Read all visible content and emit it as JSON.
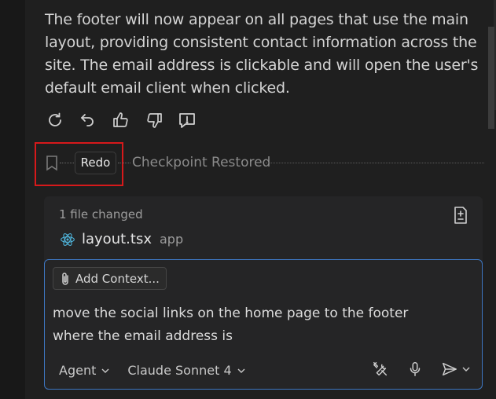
{
  "response": {
    "text": "The footer will now appear on all pages that use the main layout, providing consistent contact information across the site. The email address is clickable and will open the user's default email client when clicked."
  },
  "actions": {
    "icons": [
      "retry-icon",
      "undo-icon",
      "thumbs-up-icon",
      "thumbs-down-icon",
      "report-icon"
    ]
  },
  "checkpoint": {
    "redo_label": "Redo",
    "status_label": "Checkpoint Restored"
  },
  "files": {
    "summary": "1 file changed",
    "items": [
      {
        "name": "layout.tsx",
        "dir": "app"
      }
    ]
  },
  "input": {
    "add_context_label": "Add Context...",
    "line1": "move the social links on the home page to the footer",
    "line2": "where the email address is",
    "mode_label": "Agent",
    "model_label": "Claude Sonnet 4"
  },
  "colors": {
    "highlight": "#d7191b",
    "input_border": "#3e77c2"
  }
}
